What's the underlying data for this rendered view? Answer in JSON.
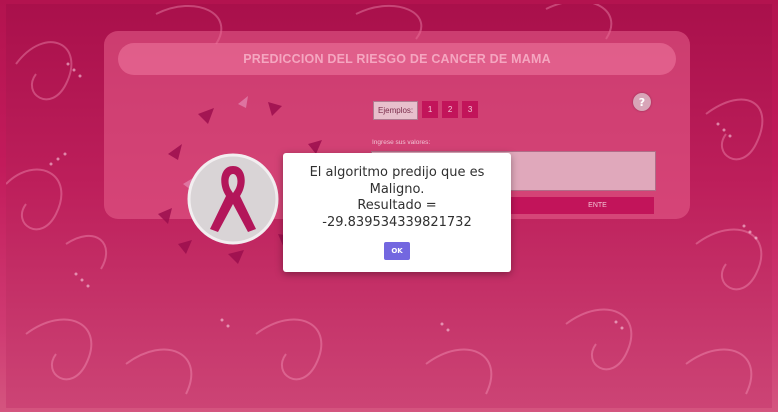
{
  "header": {
    "title": "PREDICCION DEL RIESGO DE CANCER DE MAMA"
  },
  "help": {
    "icon": "help-icon",
    "glyph": "?"
  },
  "examples": {
    "label": "Ejemplos:",
    "buttons": [
      "1",
      "2",
      "3"
    ]
  },
  "input": {
    "label": "Ingrese sus valores:",
    "value": ""
  },
  "submit": {
    "label": "ENTE"
  },
  "modal": {
    "message": "El algoritmo predijo que es\nMaligno.\nResultado =\n-29.839534339821732",
    "ok_label": "OK"
  },
  "colors": {
    "background": "#b3134f",
    "accent": "#c2145a",
    "ok_button": "#7367e0"
  }
}
